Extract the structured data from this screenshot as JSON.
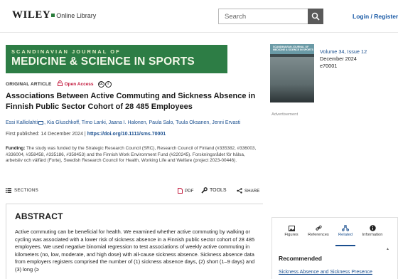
{
  "header": {
    "logo_wordmark": "WILEY",
    "logo_suffix": "Online Library",
    "search_placeholder": "Search",
    "login_label": "Login / Register"
  },
  "journal": {
    "banner_top": "SCANDINAVIAN JOURNAL OF",
    "banner_main": "MEDICINE & SCIENCE IN SPORTS"
  },
  "article": {
    "type": "ORIGINAL ARTICLE",
    "access": "Open Access",
    "title": "Associations Between Active Commuting and Sickness Absence in Finnish Public Sector Cohort of 28 485 Employees",
    "authors_before_mail": "Essi Kalliolahti",
    "authors_rest": ", Kia Gluschkoff, Timo Lanki, Jaana I. Halonen, Paula Salo, Tuula Oksanen, Jenni Ervasti",
    "first_published_label": "First published:",
    "first_published_date": "14 December 2024",
    "separator": "|",
    "doi": "https://doi.org/10.1111/sms.70001",
    "funding_label": "Funding:",
    "funding_text": "The study was funded by the Strategic Research Council (SRC), Research Council of Finland (#335382, #336003, #336004, #358458, #335186, #358453) and the Finnish Work Environment Fund (#220245). Forskningsrådet för hälsa, arbetsliv och välfärd (Forte), Swedish Research Council for Health, Working Life and Welfare (project 2023-00446)."
  },
  "toolbar": {
    "sections_label": "SECTIONS",
    "pdf_label": "PDF",
    "tools_label": "TOOLS",
    "share_label": "SHARE"
  },
  "abstract": {
    "heading": "ABSTRACT",
    "text": "Active commuting can be beneficial for health. We examined whether active commuting by walking or cycling was associated with a lower risk of sickness absence in a Finnish public sector cohort of 28 485 employees. We used negative binomial regression to test associations of weekly active commuting in kilometers (no, low, moderate, and high dose) with all-cause sickness absence. Sickness absence data from employers registers comprised the number of (1) sickness absence days, (2) short (1–9 days) and (3) long (≥"
  },
  "issue": {
    "cover_title": "SCANDINAVIAN JOURNAL OF MEDICINE & SCIENCE IN SPORTS",
    "volume": "Volume 34, Issue 12",
    "date": "December 2024",
    "article_number": "e70001",
    "advertisement_label": "Advertisement"
  },
  "side_tabs": [
    {
      "label": "Figures",
      "icon": "image-icon"
    },
    {
      "label": "References",
      "icon": "link-icon"
    },
    {
      "label": "Related",
      "icon": "related-network-icon"
    },
    {
      "label": "Information",
      "icon": "info-icon"
    }
  ],
  "recommended": {
    "heading": "Recommended",
    "first_item": "Sickness Absence and Sickness Presence"
  },
  "colors": {
    "banner_green": "#2d7d45",
    "link_blue": "#1a4f8f",
    "open_access_red": "#c2183c"
  }
}
